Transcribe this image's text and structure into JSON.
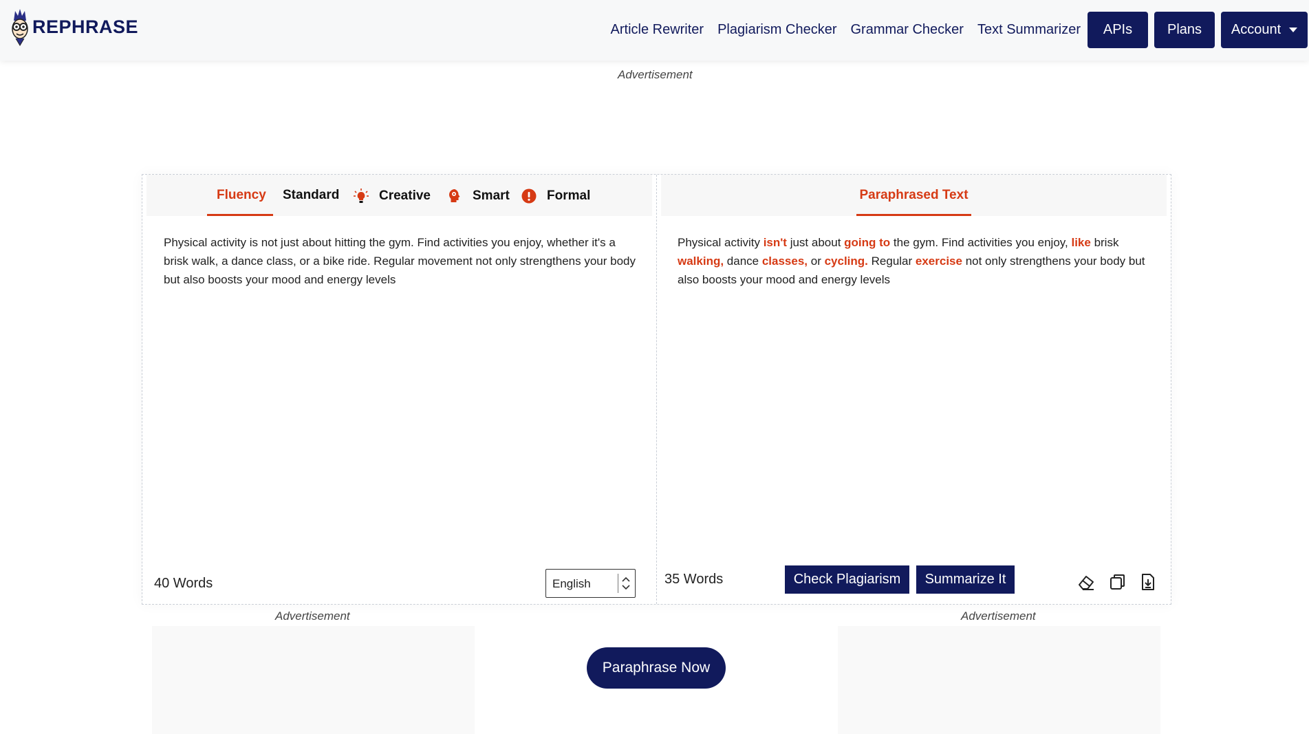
{
  "header": {
    "logo_text": "REPHRASE",
    "nav_links": [
      "Article Rewriter",
      "Plagiarism Checker",
      "Grammar Checker",
      "Text Summarizer"
    ],
    "apis_label": "APIs",
    "plans_label": "Plans",
    "account_label": "Account"
  },
  "ads": {
    "top_label": "Advertisement",
    "left_label": "Advertisement",
    "right_label": "Advertisement"
  },
  "left_pane": {
    "modes": [
      "Fluency",
      "Standard",
      "Creative",
      "Smart",
      "Formal"
    ],
    "active_mode": "Fluency",
    "input_text": "Physical activity is not just about hitting the gym. Find activities you enjoy, whether it's a brisk walk, a dance class, or a bike ride. Regular movement not only strengthens your body but also boosts your mood and energy levels",
    "word_count": "40 Words",
    "language": "English"
  },
  "right_pane": {
    "title": "Paraphrased Text",
    "segments": [
      {
        "text": "Physical activity ",
        "changed": false
      },
      {
        "text": "isn't",
        "changed": true
      },
      {
        "text": " just about ",
        "changed": false
      },
      {
        "text": "going to",
        "changed": true
      },
      {
        "text": " the gym. Find activities you enjoy, ",
        "changed": false
      },
      {
        "text": "like",
        "changed": true
      },
      {
        "text": " brisk ",
        "changed": false
      },
      {
        "text": "walking,",
        "changed": true
      },
      {
        "text": " dance ",
        "changed": false
      },
      {
        "text": "classes,",
        "changed": true
      },
      {
        "text": " or ",
        "changed": false
      },
      {
        "text": "cycling.",
        "changed": true
      },
      {
        "text": " Regular ",
        "changed": false
      },
      {
        "text": "exercise",
        "changed": true
      },
      {
        "text": " not only strengthens your body but also boosts your mood and energy levels",
        "changed": false
      }
    ],
    "word_count": "35 Words",
    "check_plagiarism_label": "Check Plagiarism",
    "summarize_label": "Summarize It"
  },
  "paraphrase_button_label": "Paraphrase Now",
  "colors": {
    "brand": "#111a5c",
    "accent": "#d63a14"
  }
}
